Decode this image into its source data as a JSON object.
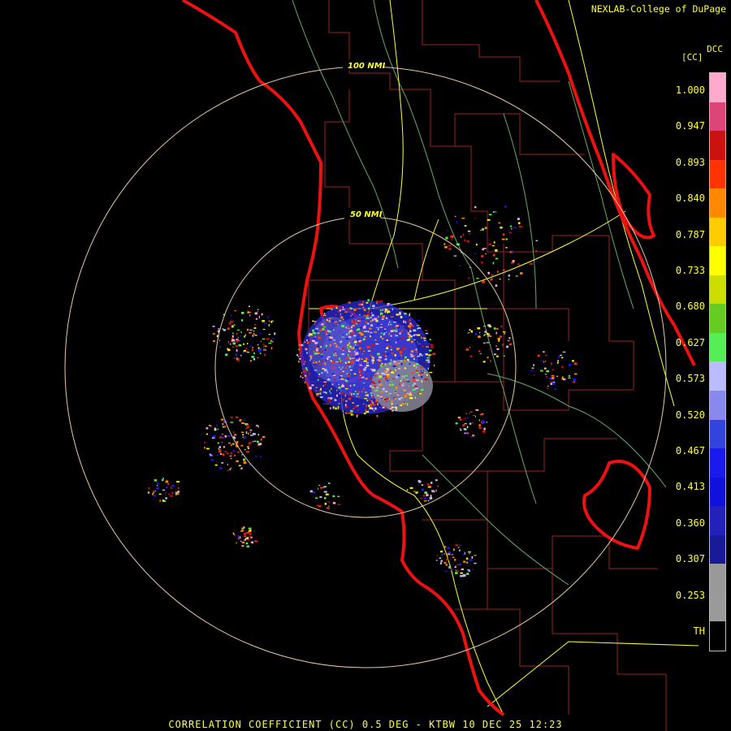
{
  "credit": "NEXLAB-College of DuPage",
  "footer": "CORRELATION COEFFICIENT (CC) 0.5 DEG - KTBW 10 DEC 25 12:23",
  "range_rings": [
    "50 NMI",
    "100 NMI"
  ],
  "legend": {
    "title": "DCC",
    "units": "[CC]",
    "labels": [
      "1.000",
      "0.947",
      "0.893",
      "0.840",
      "0.787",
      "0.733",
      "0.680",
      "0.627",
      "0.573",
      "0.520",
      "0.467",
      "0.413",
      "0.360",
      "0.307",
      "0.253",
      "TH"
    ],
    "colors": [
      "#ffaacc",
      "#dd4477",
      "#cc1111",
      "#ff3300",
      "#ff8800",
      "#ffcc00",
      "#ffff00",
      "#ccdd00",
      "#66cc22",
      "#55ee55",
      "#bbbbff",
      "#8888ee",
      "#3344dd",
      "#1a1aee",
      "#1111dd",
      "#2222bb",
      "#1a1a99",
      "#999999",
      "#9a9a9a",
      "#000000"
    ]
  },
  "colors": {
    "coast": "#ee1111",
    "county": "#aa1111",
    "roads": "#ffff33",
    "rivers": "#88cc88",
    "rings": "#e8c8a0"
  }
}
